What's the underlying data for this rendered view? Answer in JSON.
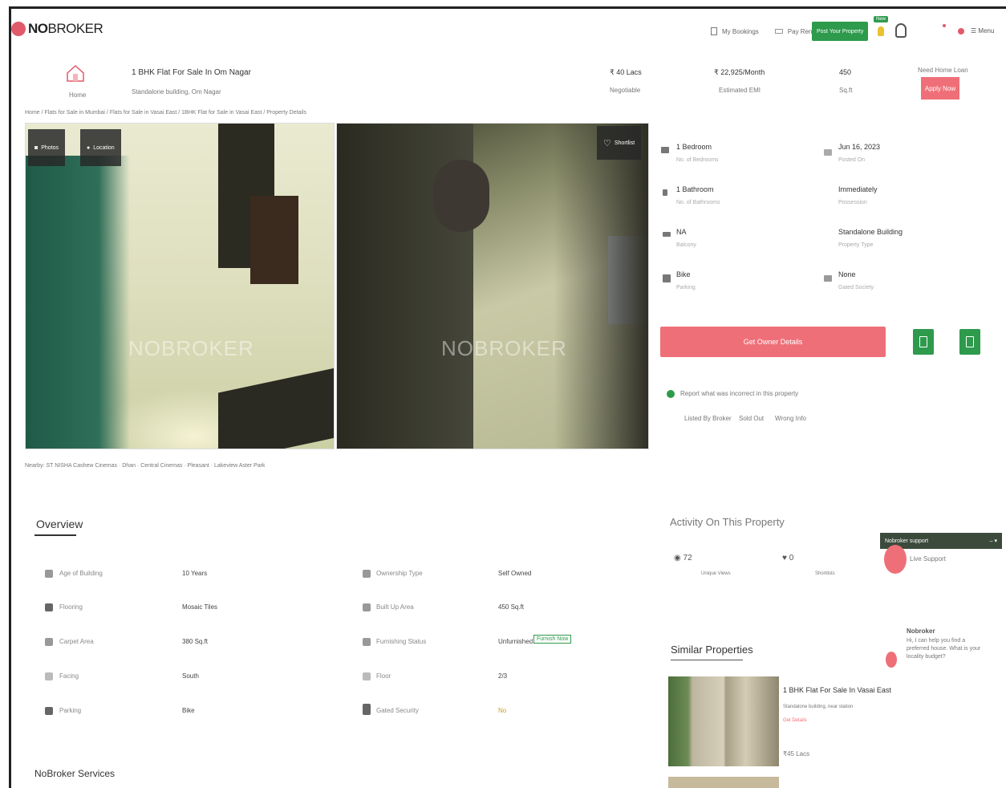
{
  "header": {
    "logo_prefix": "NO",
    "logo_suffix": "BROKER",
    "nav_bookings": "My Bookings",
    "nav_pay": "Pay Rent",
    "post_property": "Post Your Property",
    "new_badge": "New",
    "menu": "Menu"
  },
  "listing": {
    "title": "1 BHK Flat For Sale In Om Nagar",
    "subtitle": "Standalone building, Om Nagar",
    "home_label": "Home",
    "price": "₹ 40 Lacs",
    "price_sub": "Negotiable",
    "emi": "₹ 22,925/Month",
    "emi_sub": "Estimated EMI",
    "area": "450",
    "area_sub": "Sq.ft",
    "loan_text": "Need Home Loan",
    "loan_button": "Apply Now"
  },
  "breadcrumb": "Home / Flats for Sale in Mumbai / Flats for Sale in Vasai East / 1BHK Flat for Sale in Vasai East / Property Details",
  "gallery": {
    "photos_button": "Photos",
    "location_button": "Location",
    "shortlist_button": "Shortlist",
    "watermark": "NOBROKER",
    "nearby": "Nearby: ST NISHA Cashew Cinemas · Dhan · Central Cinemas · Pleasant · Lakeview Aster Park"
  },
  "details": [
    {
      "value": "1 Bedroom",
      "label": "No. of Bedrooms",
      "icon": "bed-icon"
    },
    {
      "value": "Jun 16, 2023",
      "label": "Posted On",
      "icon": "calendar-icon"
    },
    {
      "value": "1 Bathroom",
      "label": "No. of Bathrooms",
      "icon": "bath-icon"
    },
    {
      "value": "Immediately",
      "label": "Possession",
      "icon": "key-icon"
    },
    {
      "value": "NA",
      "label": "Balcony",
      "icon": "balcony-icon"
    },
    {
      "value": "Standalone Building",
      "label": "Property Type",
      "icon": "building-icon"
    },
    {
      "value": "Bike",
      "label": "Parking",
      "icon": "bike-icon"
    },
    {
      "value": "None",
      "label": "Gated Society",
      "icon": "gate-icon"
    }
  ],
  "owner_cta": "Get Owner Details",
  "report": {
    "text": "Report what was incorrect in this property",
    "opt1": "Listed By Broker",
    "opt2": "Sold Out",
    "opt3": "Wrong Info"
  },
  "overview": {
    "title": "Overview",
    "rows": [
      {
        "l1": "Age of Building",
        "v1": "10 Years",
        "l2": "Ownership Type",
        "v2": "Self Owned"
      },
      {
        "l1": "Flooring",
        "v1": "Mosaic Tiles",
        "l2": "Built Up Area",
        "v2": "450 Sq.ft"
      },
      {
        "l1": "Carpet Area",
        "v1": "380 Sq.ft",
        "l2": "Furnishing Status",
        "v2": "Unfurnished"
      },
      {
        "l1": "Facing",
        "v1": "South",
        "l2": "Floor",
        "v2": "2/3"
      },
      {
        "l1": "Parking",
        "v1": "Bike",
        "l2": "Gated Security",
        "v2": "No"
      }
    ],
    "furnish_chip": "Furnish Now"
  },
  "services_title": "NoBroker Services",
  "activity": {
    "title": "Activity On This Property",
    "views": "72",
    "views_label": "Unique Views",
    "shortlists": "0",
    "shortlists_label": "Shortlists"
  },
  "support": {
    "bar": "Nobroker support",
    "text": "Live Support",
    "agent": "Nobroker",
    "message": "Hi, I can help you find a preferred house. What is your locality budget?"
  },
  "similar": {
    "title": "Similar Properties",
    "item_title": "1 BHK Flat For Sale In Vasai East",
    "item_sub": "Standalone building, near station",
    "item_link": "Get Details",
    "item_price": "₹45 Lacs"
  },
  "colors": {
    "brand": "#ef6f78",
    "green": "#2e9a4c"
  }
}
